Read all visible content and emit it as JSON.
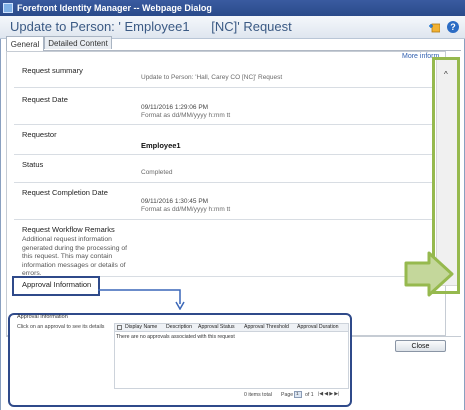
{
  "window": {
    "title": "Forefront Identity Manager -- Webpage Dialog"
  },
  "dialog": {
    "title_prefix": "Update to Person: '",
    "title_name": "Employee1",
    "title_suffix": "[NC]' Request"
  },
  "tabs": [
    {
      "label": "General",
      "active": true
    },
    {
      "label": "Detailed Content",
      "active": false
    }
  ],
  "more_info": "More inform",
  "fields": {
    "request_summary": {
      "label": "Request summary",
      "value": "Update to Person: 'Hall, Carey CO [NC]' Request"
    },
    "request_date": {
      "label": "Request Date",
      "value": "09/11/2016 1:29:06 PM",
      "format": "Format as dd/MM/yyyy h:mm tt"
    },
    "requestor": {
      "label": "Requestor",
      "value": "Employee1"
    },
    "status": {
      "label": "Status",
      "value": "Completed"
    },
    "completion_date": {
      "label": "Request Completion Date",
      "value": "09/11/2016 1:30:45 PM",
      "format": "Format as dd/MM/yyyy h:mm tt"
    },
    "remarks": {
      "label": "Request Workflow Remarks",
      "desc_lines": [
        "Additional request information",
        "generated during the processing of",
        "this request. This may contain",
        "information messages or details of",
        "errors."
      ]
    },
    "approval_information": {
      "label": "Approval Information"
    }
  },
  "approval_panel": {
    "title": "Approval Information",
    "hint": "Click on an approval to see its details",
    "columns": [
      "Display Name",
      "Description",
      "Approval Status",
      "Approval Threshold",
      "Approval Duration"
    ],
    "empty_message": "There are no approvals associated with this request",
    "items_total": "0 items total",
    "page_label": "Page",
    "page_value": "1",
    "page_of": "of 1",
    "pager_icons": "|◀ ◀ ▶ ▶|"
  },
  "buttons": {
    "close": "Close"
  },
  "accent_colors": {
    "highlight_frame": "#96b94e",
    "annotation_box": "#2f4a8a",
    "title_blue": "#3b5a84"
  }
}
